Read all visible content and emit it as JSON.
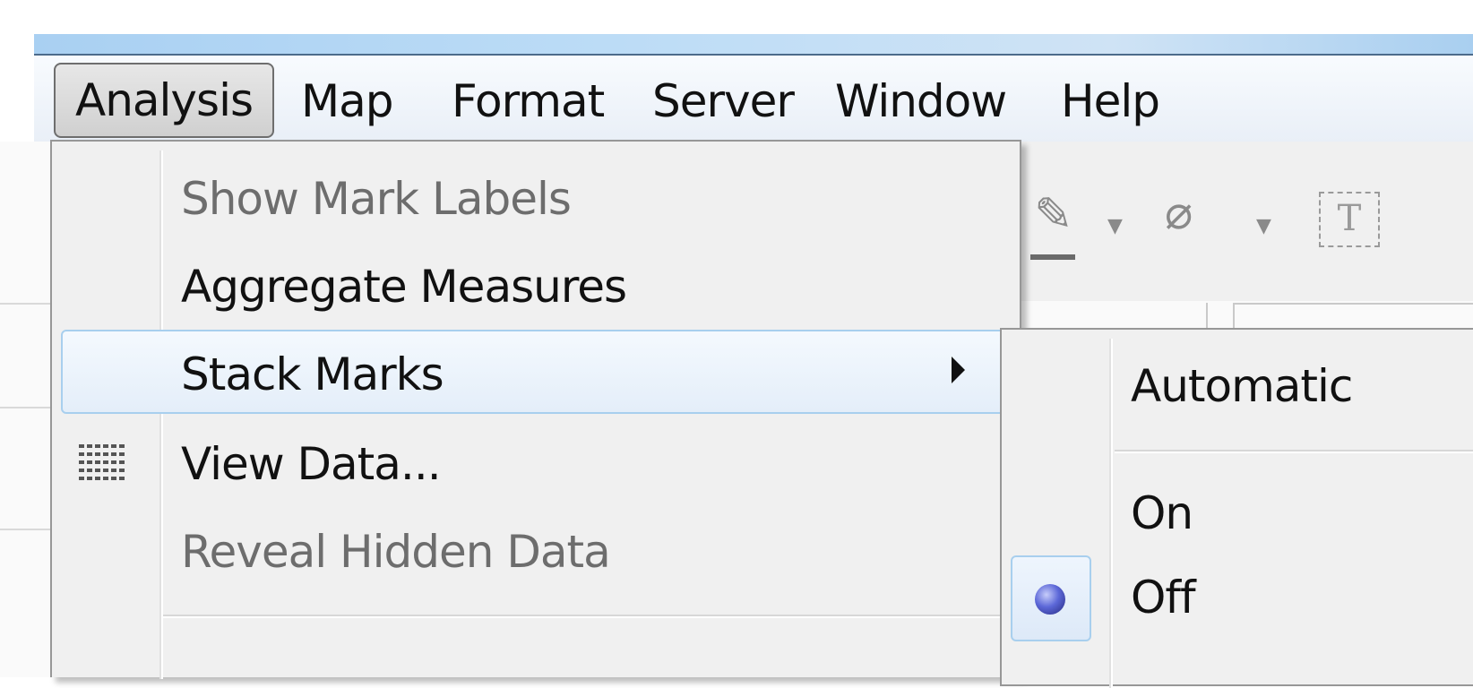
{
  "menubar": {
    "items": [
      "Analysis",
      "Map",
      "Format",
      "Server",
      "Window",
      "Help"
    ],
    "active": "Analysis"
  },
  "analysis_menu": {
    "items": [
      {
        "label": "Show Mark Labels",
        "enabled": false
      },
      {
        "label": "Aggregate Measures",
        "enabled": true
      },
      {
        "label": "Stack Marks",
        "enabled": true,
        "submenu": true,
        "highlighted": true
      },
      {
        "label": "View Data...",
        "enabled": true,
        "icon": "table-grid-icon"
      },
      {
        "label": "Reveal Hidden Data",
        "enabled": false
      }
    ]
  },
  "stack_marks_submenu": {
    "items": [
      {
        "label": "Automatic"
      },
      {
        "label": "On"
      },
      {
        "label": "Off",
        "selected": true
      }
    ]
  },
  "toolbar": {
    "icons": [
      "highlighter-icon",
      "dropdown-arrow-icon",
      "paperclip-icon",
      "dropdown-arrow-icon",
      "text-box-icon"
    ],
    "text_box_glyph": "T"
  },
  "colors": {
    "menu_highlight_border": "#a8cfee",
    "menu_background": "#f0f0f0",
    "disabled_text": "#6d6d6d",
    "radio_dot": "#4a55c9"
  }
}
